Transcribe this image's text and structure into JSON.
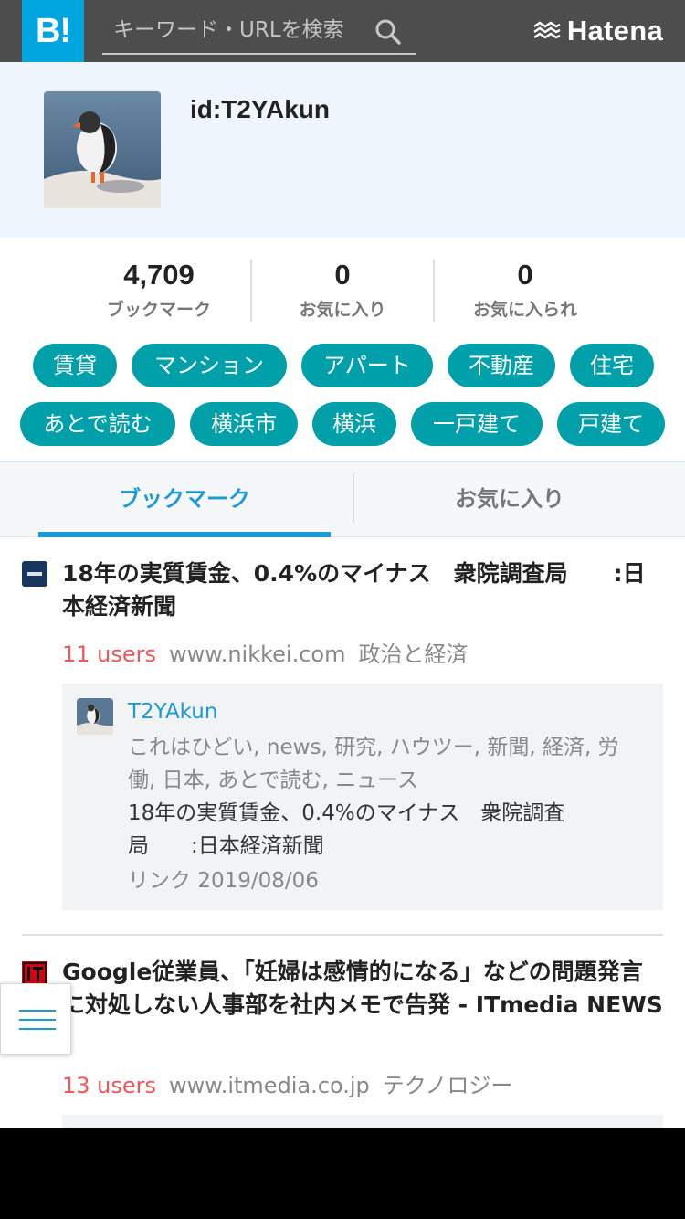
{
  "header": {
    "logo_text": "B!",
    "search_placeholder": "キーワード・URLを検索",
    "brand": "Hatena",
    "accent": "#00a4de"
  },
  "profile": {
    "username": "id:T2YAkun"
  },
  "stats": [
    {
      "value": "4,709",
      "label": "ブックマーク"
    },
    {
      "value": "0",
      "label": "お気に入り"
    },
    {
      "value": "0",
      "label": "お気に入られ"
    }
  ],
  "tags": [
    [
      "賃貸",
      "マンション",
      "アパート",
      "不動産",
      "住宅"
    ],
    [
      "あとで読む",
      "横浜市",
      "横浜",
      "一戸建て",
      "戸建て"
    ]
  ],
  "tabs": {
    "active": "ブックマーク",
    "other": "お気に入り"
  },
  "entries": [
    {
      "title": "18年の実質賃金、0.4%のマイナス　衆院調査局　　:日本経済新聞",
      "users": "11 users",
      "site": "www.nikkei.com",
      "category": "政治と経済",
      "favicon": "nikkei-icon",
      "comment": {
        "user": "T2YAkun",
        "tags": "これはひどい, news, 研究, ハウツー, 新聞, 経済, 労働, 日本, あとで読む, ニュース",
        "text": "18年の実質賃金、0.4%のマイナス　衆院調査局　　:日本経済新聞",
        "date": "リンク 2019/08/06"
      }
    },
    {
      "title": "Google従業員、「妊婦は感情的になる」などの問題発言に対処しない人事部を社内メモで告発 - ITmedia NEWS",
      "users": "13 users",
      "site": "www.itmedia.co.jp",
      "category": "テクノロジー",
      "favicon": "itmedia-icon"
    }
  ],
  "colors": {
    "tag": "#00a0aa",
    "link": "#1a9ad6",
    "users": "#f0565a"
  }
}
